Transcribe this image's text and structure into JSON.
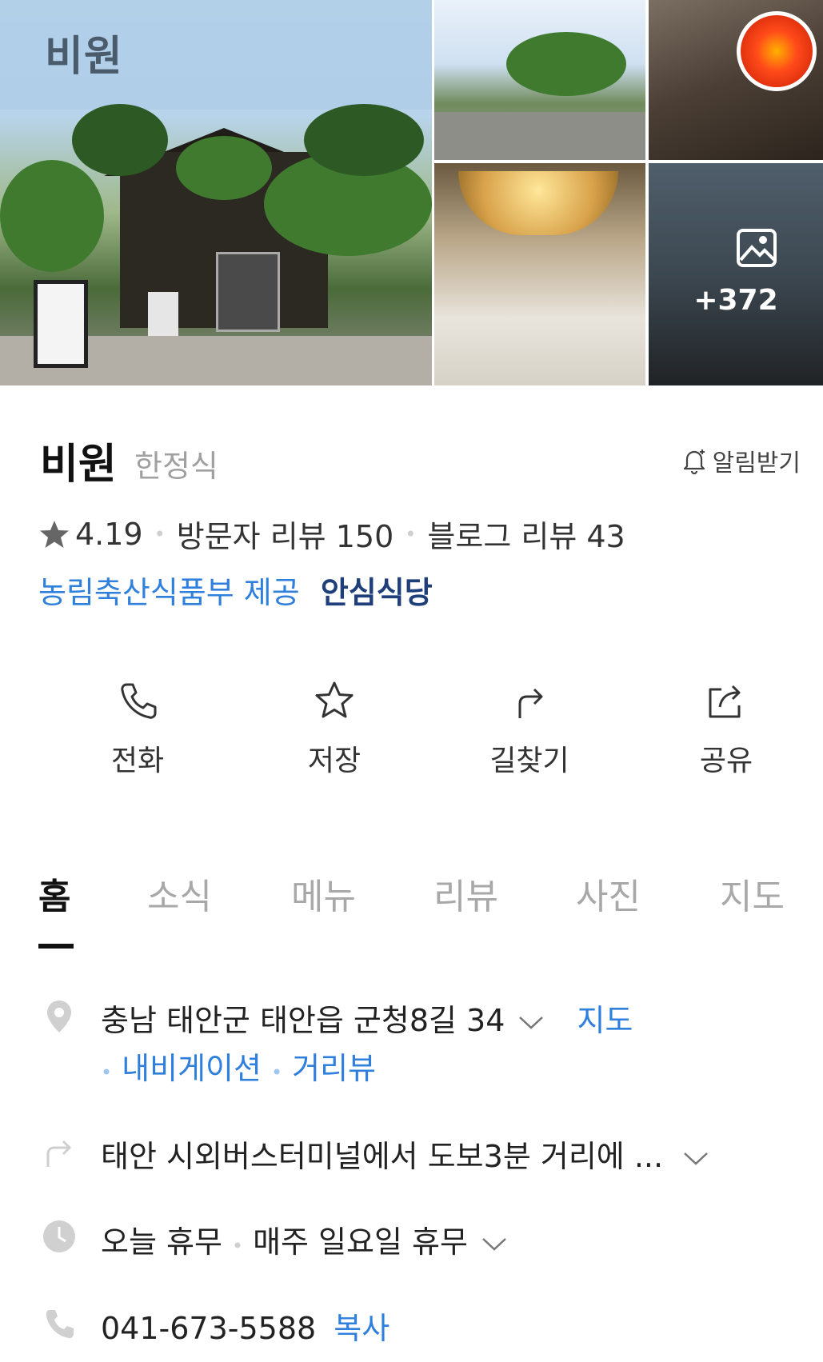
{
  "gallery": {
    "title": "비원",
    "more_count": "+372"
  },
  "place": {
    "name": "비원",
    "category": "한정식",
    "notify_label": "알림받기",
    "rating": "4.19",
    "visitor_reviews": "방문자 리뷰 150",
    "blog_reviews": "블로그 리뷰 43",
    "provider": "농림축산식품부 제공",
    "safe_badge": "안심식당"
  },
  "actions": {
    "call": "전화",
    "save": "저장",
    "route": "길찾기",
    "share": "공유"
  },
  "tabs": [
    {
      "label": "홈",
      "active": true
    },
    {
      "label": "소식",
      "active": false
    },
    {
      "label": "메뉴",
      "active": false
    },
    {
      "label": "리뷰",
      "active": false
    },
    {
      "label": "사진",
      "active": false
    },
    {
      "label": "지도",
      "active": false
    }
  ],
  "details": {
    "address": "충남 태안군 태안읍 군청8길 34",
    "map_link": "지도",
    "navigation_link": "내비게이션",
    "street_view_link": "거리뷰",
    "directions": "태안 시외버스터미널에서 도보3분 거리에 ...",
    "hours_today": "오늘 휴무",
    "hours_regular": "매주 일요일 휴무",
    "phone": "041-673-5588",
    "copy_link": "복사"
  },
  "colors": {
    "accent_blue": "#2f7fdc",
    "safe_navy": "#1f3f7a",
    "muted_gray": "#a8a8a8"
  },
  "icons": [
    "star-icon",
    "bell-icon",
    "phone-icon",
    "star-outline-icon",
    "route-arrow-icon",
    "share-icon",
    "location-pin-icon",
    "direction-arrow-icon",
    "clock-icon",
    "photo-icon"
  ]
}
